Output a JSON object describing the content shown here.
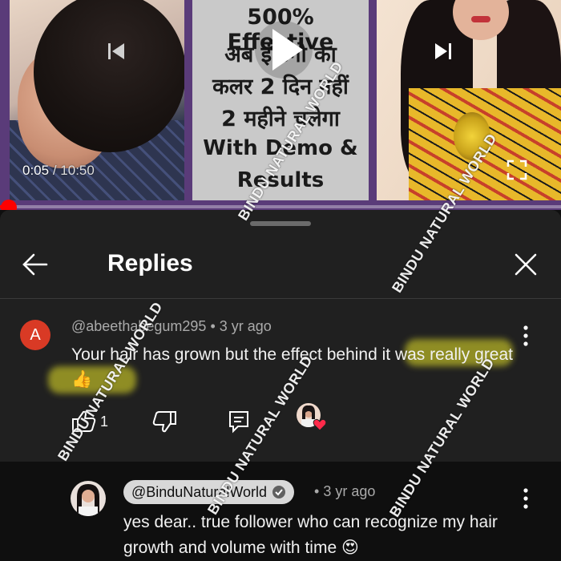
{
  "player": {
    "time_current": "0:05",
    "time_separator": "/",
    "time_total": "10:50",
    "progress_fraction": 0.008,
    "thumbnail_text": [
      "500% Effective",
      "अब इंडिगो का",
      "कलर 2 दिन नहीं",
      "2 महीने चलेगा",
      "With Demo &",
      "Results"
    ],
    "icons": {
      "prev": "skip-previous-icon",
      "play": "play-icon",
      "next": "skip-next-icon",
      "fullscreen": "fullscreen-icon"
    }
  },
  "sheet": {
    "title": "Replies",
    "back_icon": "arrow-back-icon",
    "close_icon": "close-icon"
  },
  "comment": {
    "avatar_letter": "A",
    "avatar_color": "#d93a25",
    "author": "@abeethabegum295",
    "time": "3 yr ago",
    "text": "Your hair has grown but the effect behind it was really great👍",
    "like_count": "1",
    "liked_by_creator": true
  },
  "reply": {
    "author": "@BinduNaturalWorld",
    "verified": true,
    "time": "3 yr ago",
    "text": "yes dear.. true follower who can recognize my hair growth and volume with time 😍"
  },
  "watermark": "BINDU NATURAL WORLD",
  "colors": {
    "accent_red": "#ff0000",
    "highlight": "#f5f32b",
    "sheet_bg": "#202020",
    "page_bg": "#0f0f0f"
  }
}
